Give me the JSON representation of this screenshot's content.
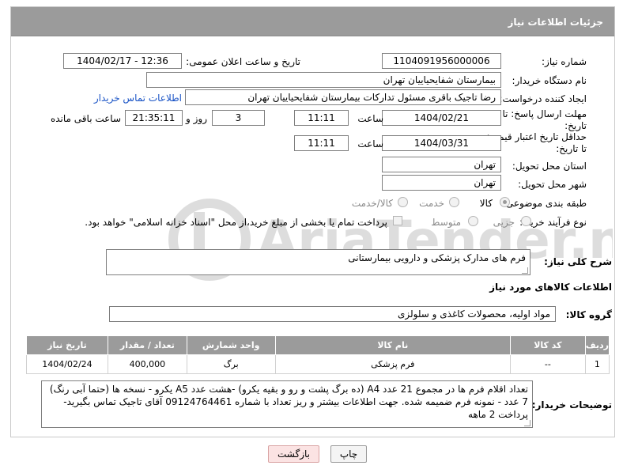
{
  "header": {
    "title": "جزئیات اطلاعات نیاز"
  },
  "fields": {
    "need_number_label": "شماره نیاز:",
    "need_number": "1104091956000006",
    "announce_label": "تاریخ و ساعت اعلان عمومی:",
    "announce_value": "1404/02/17 - 12:36",
    "buyer_org_label": "نام دستگاه خریدار:",
    "buyer_org": "بیمارستان شفایحیاییان تهران",
    "creator_label": "ایجاد کننده درخواست:",
    "creator": "رضا تاجیک باقری مسئول تدارکات بیمارستان شفایحیاییان تهران",
    "contact_link": "اطلاعات تماس خریدار",
    "reply_deadline_label": "مهلت ارسال پاسخ: تا تاریخ:",
    "reply_date": "1404/02/21",
    "time_label": "ساعت",
    "reply_time": "11:11",
    "days_value": "3",
    "days_label": "روز و",
    "remaining_time": "21:35:11",
    "remaining_label": "ساعت باقی مانده",
    "price_validity_label": "حداقل تاریخ اعتبار قیمت: تا تاریخ:",
    "price_date": "1404/03/31",
    "price_time": "11:11",
    "province_label": "استان محل تحویل:",
    "province": "تهران",
    "city_label": "شهر محل تحویل:",
    "city": "تهران",
    "category_label": "طبقه بندی موضوعی:",
    "category_options": [
      "کالا",
      "خدمت",
      "کالا/خدمت"
    ],
    "process_label": "نوع فرآیند خرید :",
    "process_options": [
      "جزیی",
      "متوسط"
    ],
    "payment_note": "پرداخت تمام یا بخشی از مبلغ خرید،از محل \"اسناد خزانه اسلامی\" خواهد بود."
  },
  "summary": {
    "label": "شرح کلی نیاز:",
    "value": "فرم های مدارک پزشکی و دارویی بیمارستانی"
  },
  "goods": {
    "section_title": "اطلاعات کالاهای مورد نیاز",
    "group_label": "گروه کالا:",
    "group_value": "مواد اولیه، محصولات کاغذی و سلولزی"
  },
  "table": {
    "headers": [
      "ردیف",
      "کد کالا",
      "نام کالا",
      "واحد شمارش",
      "تعداد / مقدار",
      "تاریخ نیاز"
    ],
    "rows": [
      [
        "1",
        "--",
        "فرم پزشکی",
        "برگ",
        "400,000",
        "1404/02/24"
      ]
    ]
  },
  "buyer_notes": {
    "label": "توضیحات خریدار:",
    "value": "تعداد اقلام فرم ها در مجموع 21 عدد A4 (ده برگ پشت و رو و بقیه یکرو) -هشت عدد A5 یکرو - نسخه ها (حتما آبی رنگ) 7 عدد - نمونه فرم ضمیمه شده. جهت اطلاعات بیشتر و ریز تعداد با شماره 09124764461 آقای تاجیک تماس بگیرید- پرداخت 2 ماهه"
  },
  "buttons": {
    "print": "چاپ",
    "back": "بازگشت"
  },
  "watermark": {
    "text": "AriaTender.neT"
  }
}
